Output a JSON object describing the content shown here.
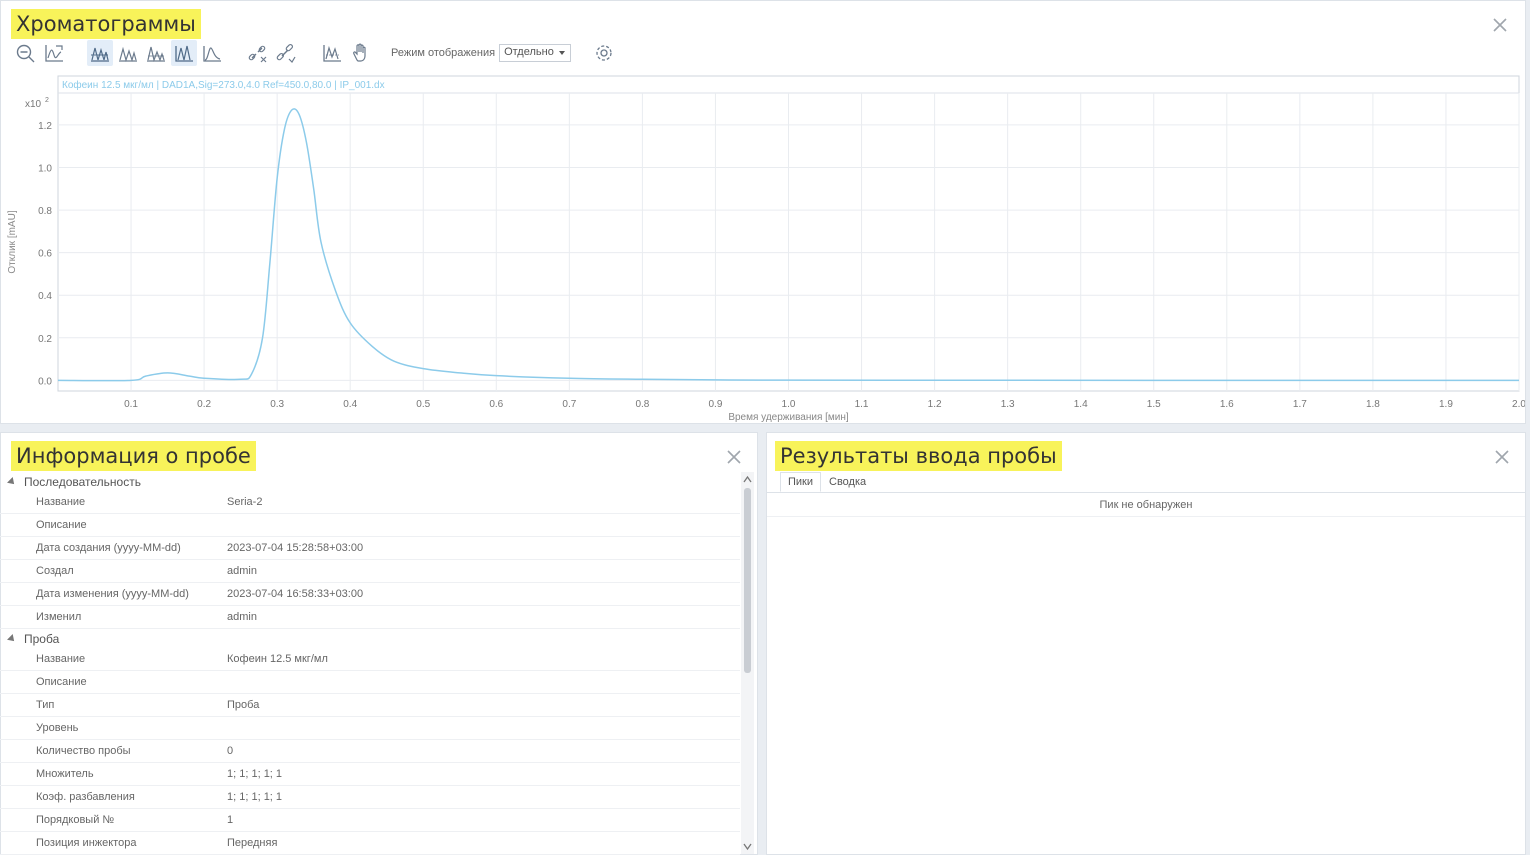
{
  "chromatograms": {
    "title": "Хроматограммы",
    "mode_label": "Режим отображения",
    "mode_value": "Отдельно",
    "trace_label": "Кофеин 12.5 мкг/мл | DAD1A,Sig=273.0,4.0  Ref=450.0,80.0 | IP_001.dx"
  },
  "chart_data": {
    "type": "line",
    "ylabel": "Отклик [mAU]",
    "y_exponent_label": "x10",
    "y_exponent": "2",
    "xlabel": "Время удерживания [мин]",
    "xlim": [
      0,
      2.0
    ],
    "ylim": [
      -0.05,
      1.35
    ],
    "x_ticks": [
      "0.1",
      "0.2",
      "0.3",
      "0.4",
      "0.5",
      "0.6",
      "0.7",
      "0.8",
      "0.9",
      "1.0",
      "1.1",
      "1.2",
      "1.3",
      "1.4",
      "1.5",
      "1.6",
      "1.7",
      "1.8",
      "1.9",
      "2.0"
    ],
    "y_ticks": [
      "0.0",
      "0.2",
      "0.4",
      "0.6",
      "0.8",
      "1.0",
      "1.2"
    ],
    "grid": true,
    "series": [
      {
        "color": "#8ccbea",
        "x": [
          0.0,
          0.1,
          0.12,
          0.15,
          0.18,
          0.2,
          0.25,
          0.265,
          0.28,
          0.29,
          0.3,
          0.31,
          0.32,
          0.33,
          0.34,
          0.35,
          0.36,
          0.38,
          0.4,
          0.43,
          0.46,
          0.5,
          0.55,
          0.6,
          0.7,
          0.8,
          0.9,
          1.0,
          1.5,
          2.0
        ],
        "y": [
          0.0,
          0.0,
          0.02,
          0.035,
          0.02,
          0.01,
          0.005,
          0.03,
          0.2,
          0.55,
          0.95,
          1.18,
          1.27,
          1.25,
          1.12,
          0.9,
          0.65,
          0.42,
          0.27,
          0.16,
          0.09,
          0.055,
          0.035,
          0.022,
          0.01,
          0.005,
          0.002,
          0.001,
          0.0,
          0.0
        ]
      }
    ]
  },
  "sample_info": {
    "title": "Информация о пробе",
    "groups": [
      {
        "name": "Последовательность",
        "rows": [
          {
            "name": "Название",
            "value": "Seria-2"
          },
          {
            "name": "Описание",
            "value": ""
          },
          {
            "name": "Дата создания (yyyy-MM-dd)",
            "value": "2023-07-04 15:28:58+03:00"
          },
          {
            "name": "Создал",
            "value": "admin"
          },
          {
            "name": "Дата изменения (yyyy-MM-dd)",
            "value": "2023-07-04 16:58:33+03:00"
          },
          {
            "name": "Изменил",
            "value": "admin"
          }
        ]
      },
      {
        "name": "Проба",
        "rows": [
          {
            "name": "Название",
            "value": "Кофеин 12.5 мкг/мл"
          },
          {
            "name": "Описание",
            "value": ""
          },
          {
            "name": "Тип",
            "value": "Проба"
          },
          {
            "name": "Уровень",
            "value": ""
          },
          {
            "name": "Количество пробы",
            "value": "0"
          },
          {
            "name": "Множитель",
            "value": "1; 1; 1; 1; 1"
          },
          {
            "name": "Коэф. разбавления",
            "value": "1; 1; 1; 1; 1"
          },
          {
            "name": "Порядковый №",
            "value": "1"
          },
          {
            "name": "Позиция инжектора",
            "value": "Передняя"
          }
        ]
      }
    ]
  },
  "results": {
    "title": "Результаты ввода пробы",
    "tabs": [
      "Пики",
      "Сводка"
    ],
    "empty_message": "Пик не обнаружен"
  },
  "colors": {
    "highlight": "#f8f35a",
    "trace": "#8ccbea",
    "toolbar_icon": "#6b7a8c"
  }
}
